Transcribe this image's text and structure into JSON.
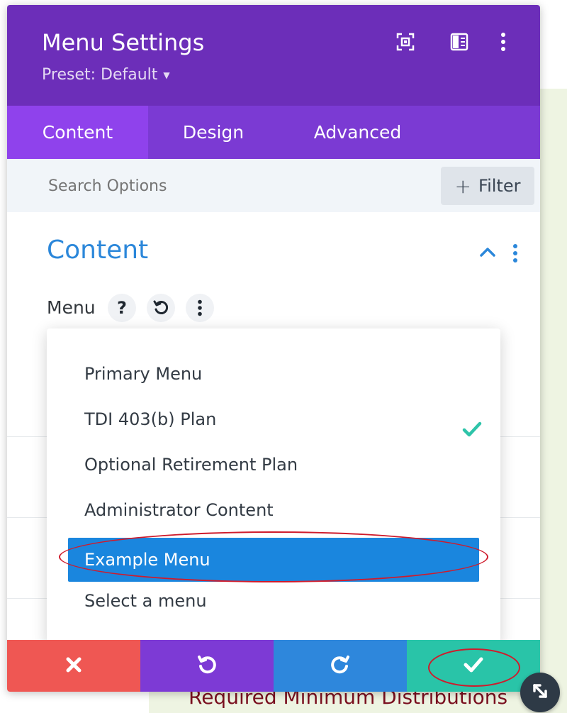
{
  "header": {
    "title": "Menu Settings",
    "preset_label": "Preset: Default",
    "icons": [
      "focus-mode-icon",
      "sidebar-layout-icon",
      "more-vertical-icon"
    ]
  },
  "tabs": [
    {
      "label": "Content",
      "active": true
    },
    {
      "label": "Design",
      "active": false
    },
    {
      "label": "Advanced",
      "active": false
    }
  ],
  "search": {
    "placeholder": "Search Options",
    "filter_label": "Filter"
  },
  "section": {
    "title": "Content"
  },
  "field": {
    "label": "Menu",
    "icons": [
      "help-icon",
      "reset-icon",
      "more-vertical-icon"
    ]
  },
  "dropdown": {
    "options": [
      {
        "label": "Primary Menu",
        "selected": false,
        "highlighted": false
      },
      {
        "label": "TDI 403(b) Plan",
        "selected": true,
        "highlighted": false
      },
      {
        "label": "Optional Retirement Plan",
        "selected": false,
        "highlighted": false
      },
      {
        "label": "Administrator Content",
        "selected": false,
        "highlighted": false
      },
      {
        "label": "Example Menu",
        "selected": false,
        "highlighted": true
      },
      {
        "label": "Select a menu",
        "selected": false,
        "highlighted": false
      }
    ]
  },
  "footer": {
    "buttons": [
      {
        "name": "discard",
        "icon": "close-icon",
        "color": "#ef5753"
      },
      {
        "name": "undo",
        "icon": "undo-icon",
        "color": "#7d3ad5"
      },
      {
        "name": "redo",
        "icon": "redo-icon",
        "color": "#2e87dc"
      },
      {
        "name": "save",
        "icon": "check-icon",
        "color": "#29c4a8"
      }
    ]
  },
  "background": {
    "text": "Required Minimum Distributions"
  },
  "colors": {
    "header": "#6c2eb9",
    "tabs": "#7b3ad3",
    "tab_active": "#8f42ec",
    "accent": "#2b87da",
    "highlight": "#1a86de",
    "check": "#2ec4a9",
    "annotation": "#cf1b2c"
  }
}
